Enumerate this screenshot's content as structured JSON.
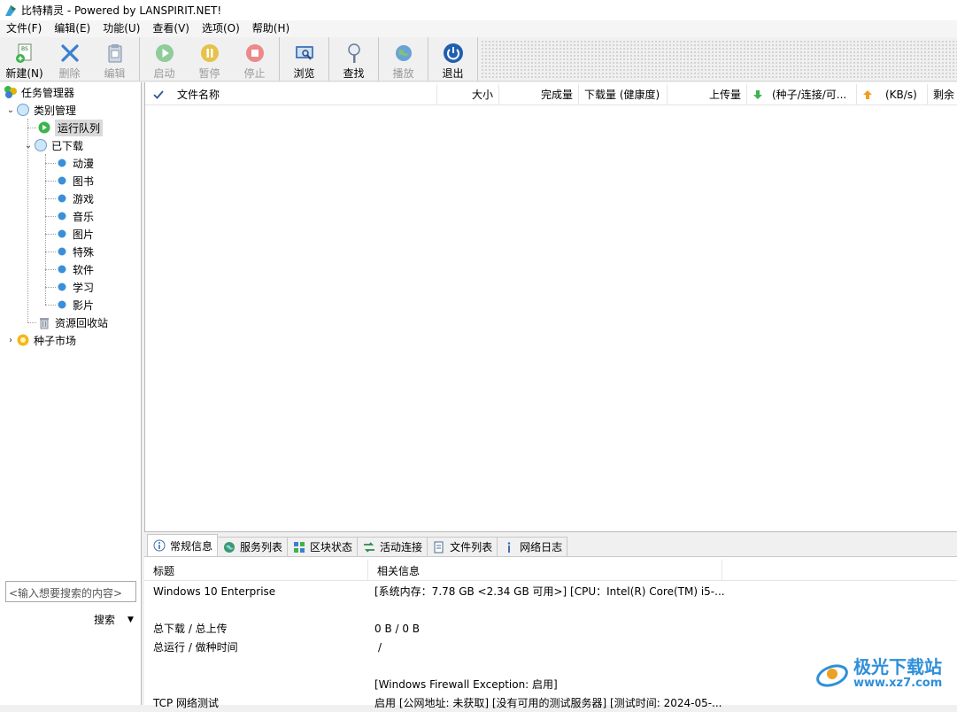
{
  "window": {
    "title": "比特精灵 - Powered by LANSPIRIT.NET!"
  },
  "menu": [
    "文件(F)",
    "编辑(E)",
    "功能(U)",
    "查看(V)",
    "选项(O)",
    "帮助(H)"
  ],
  "toolbar": {
    "new": "新建(N)",
    "delete": "删除",
    "edit": "编辑",
    "start": "启动",
    "pause": "暂停",
    "stop": "停止",
    "browse": "浏览",
    "find": "查找",
    "play": "播放",
    "exit": "退出"
  },
  "tree": {
    "root": "任务管理器",
    "category": "类别管理",
    "running": "运行队列",
    "downloaded": "已下载",
    "sub": [
      "动漫",
      "图书",
      "游戏",
      "音乐",
      "图片",
      "特殊",
      "软件",
      "学习",
      "影片"
    ],
    "recycle": "资源回收站",
    "market": "种子市场"
  },
  "search": {
    "placeholder": "<输入想要搜索的内容>",
    "button": "搜索"
  },
  "columns": [
    "文件名称",
    "大小",
    "完成量",
    "下载量 (健康度)",
    "上传量",
    "(种子/连接/可...",
    "(KB/s)",
    "剩余"
  ],
  "tabs": [
    "常规信息",
    "服务列表",
    "区块状态",
    "活动连接",
    "文件列表",
    "网络日志"
  ],
  "info": {
    "headers": [
      "标题",
      "相关信息"
    ],
    "rows": [
      {
        "k": "Windows 10 Enterprise",
        "v": "[系统内存：7.78 GB <2.34 GB 可用>] [CPU：Intel(R) Core(TM) i5-..."
      },
      {
        "k": "总下载 / 总上传",
        "v": "0 B / 0 B"
      },
      {
        "k": "总运行 / 做种时间",
        "v": "/"
      },
      {
        "k": "",
        "v": "[Windows Firewall Exception: 启用]"
      },
      {
        "k": "TCP 网络测试",
        "v": "启用 [公网地址: 未获取] [没有可用的测试服务器] [测试时间: 2024-05-..."
      }
    ]
  },
  "watermark": {
    "main": "极光下载站",
    "sub": "www.xz7.com"
  },
  "colors": {
    "accent": "#2f8fd8",
    "green": "#3cb44b",
    "yellow": "#e0b400",
    "red": "#e05050"
  }
}
